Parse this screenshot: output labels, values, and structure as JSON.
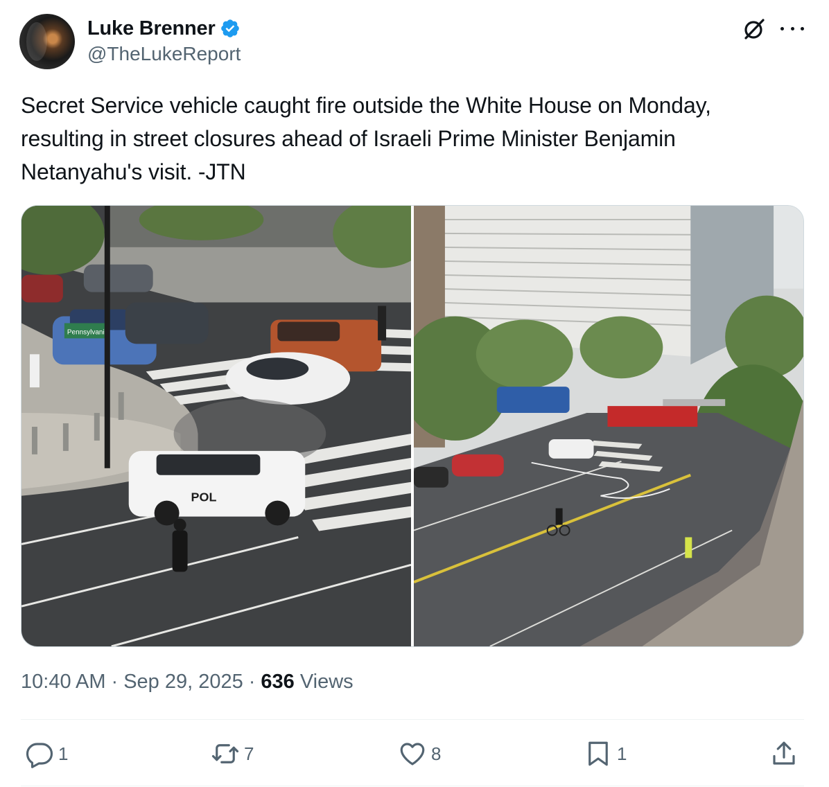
{
  "author": {
    "name": "Luke Brenner",
    "handle": "@TheLukeReport",
    "verified": true,
    "verified_color": "#1d9bf0"
  },
  "header_icons": [
    "grok-icon",
    "more-icon"
  ],
  "tweet": {
    "text": "Secret Service vehicle caught fire outside the White House on Monday, resulting in street closures ahead of Israeli Prime Minister Benjamin Netanyahu's visit. -JTN"
  },
  "media": {
    "photos": [
      {
        "sign_text": "Pennsylvania",
        "vehicle_text": "POL"
      },
      {}
    ]
  },
  "meta": {
    "time": "10:40 AM",
    "separator": "·",
    "date": "Sep 29, 2025",
    "views_count": "636",
    "views_label": "Views"
  },
  "actions": {
    "reply": {
      "icon": "reply-icon",
      "count": "1"
    },
    "retweet": {
      "icon": "retweet-icon",
      "count": "7"
    },
    "like": {
      "icon": "heart-icon",
      "count": "8"
    },
    "bookmark": {
      "icon": "bookmark-icon",
      "count": "1"
    },
    "share": {
      "icon": "share-icon"
    }
  },
  "colors": {
    "text_primary": "#0f1419",
    "text_secondary": "#536471",
    "divider": "#eff3f4",
    "accent": "#1d9bf0"
  }
}
